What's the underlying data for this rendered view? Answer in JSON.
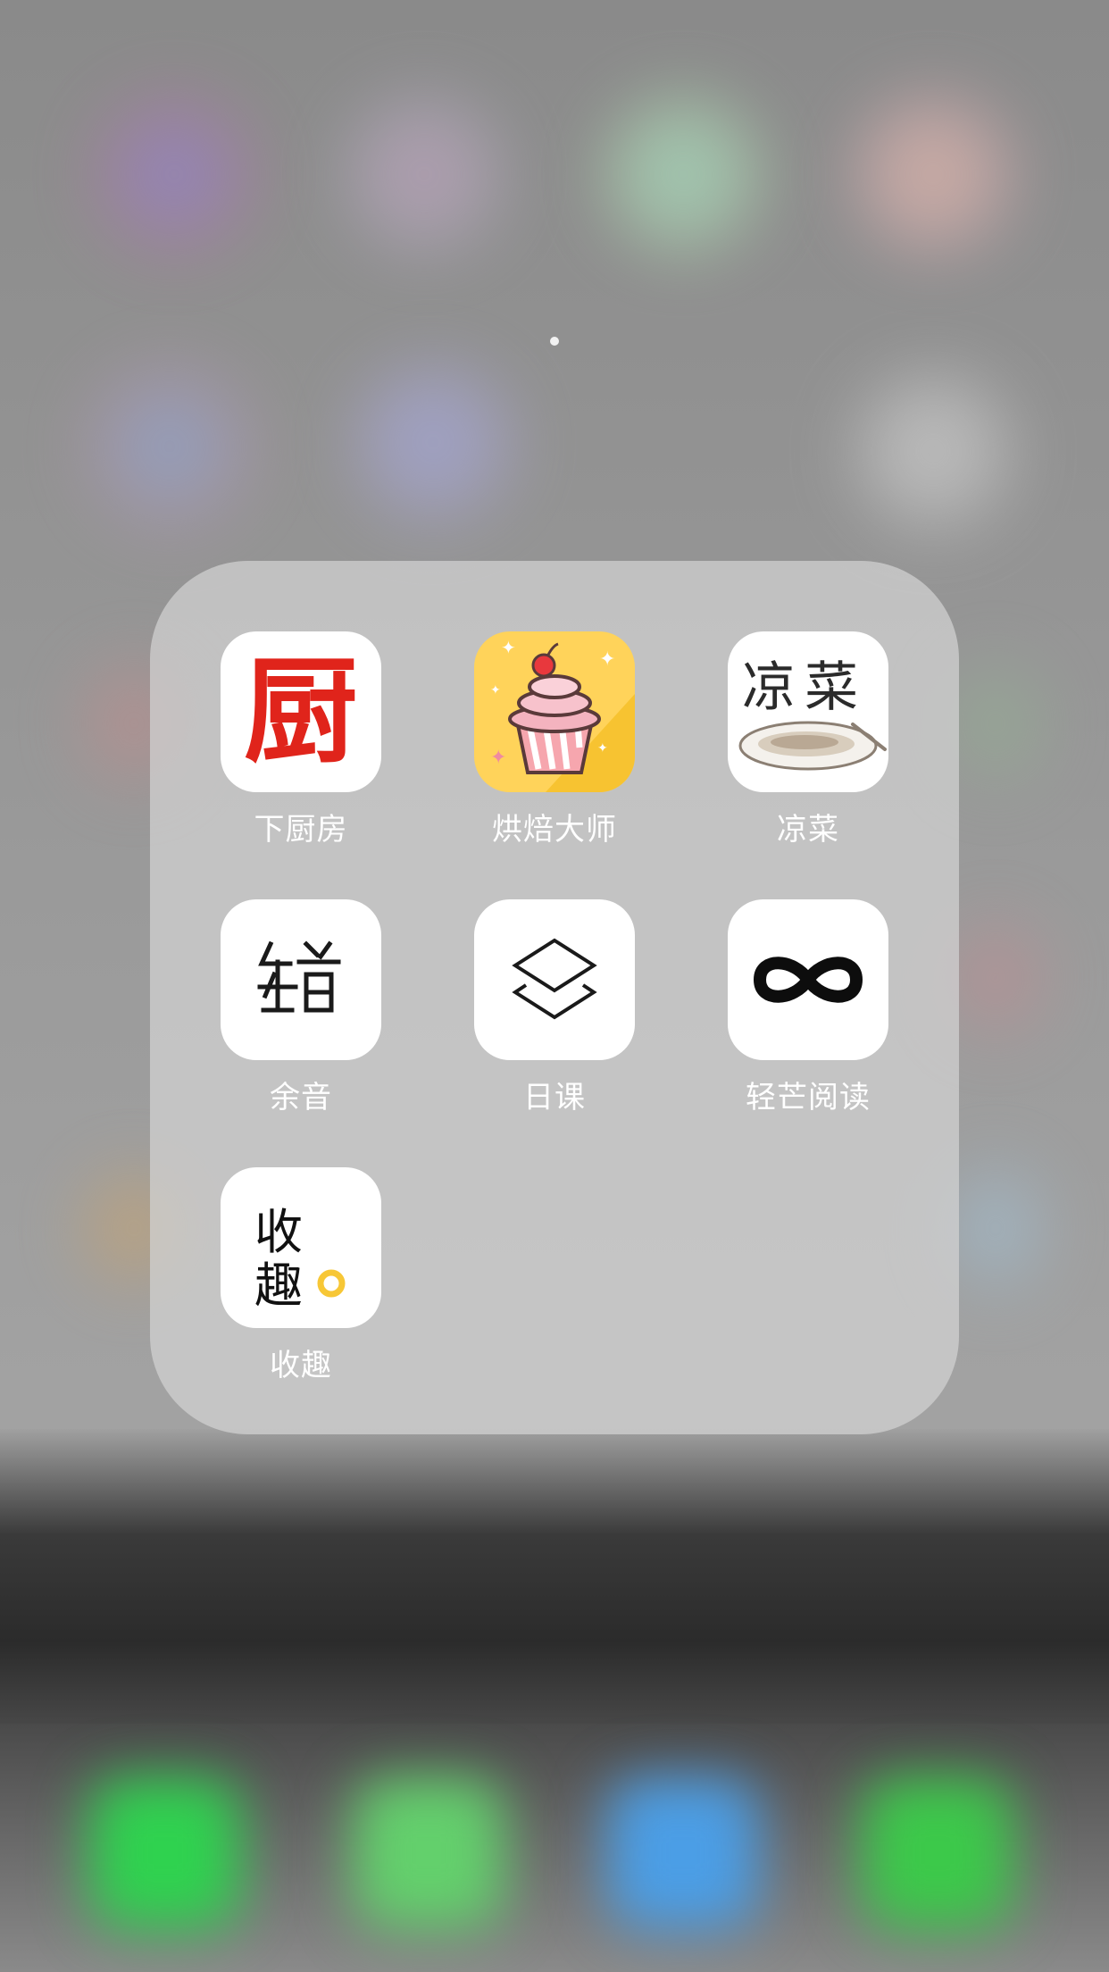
{
  "folder": {
    "apps": [
      {
        "label": "下厨房",
        "icon": "xiachufang-icon",
        "glyph": "厨",
        "accent": "#e0241b"
      },
      {
        "label": "烘焙大师",
        "icon": "cupcake-icon",
        "accent": "#ffd35a"
      },
      {
        "label": "凉菜",
        "icon": "cold-dish-icon",
        "glyph": "凉菜"
      },
      {
        "label": "余音",
        "icon": "yuyin-icon"
      },
      {
        "label": "日课",
        "icon": "layers-icon"
      },
      {
        "label": "轻芒阅读",
        "icon": "infinity-icon"
      },
      {
        "label": "收趣",
        "icon": "shouqu-icon",
        "glyph_1": "收",
        "glyph_2": "趣",
        "accent": "#f7c736"
      }
    ]
  },
  "home": {
    "page_indicator": {
      "pages": 1,
      "current": 1
    }
  }
}
